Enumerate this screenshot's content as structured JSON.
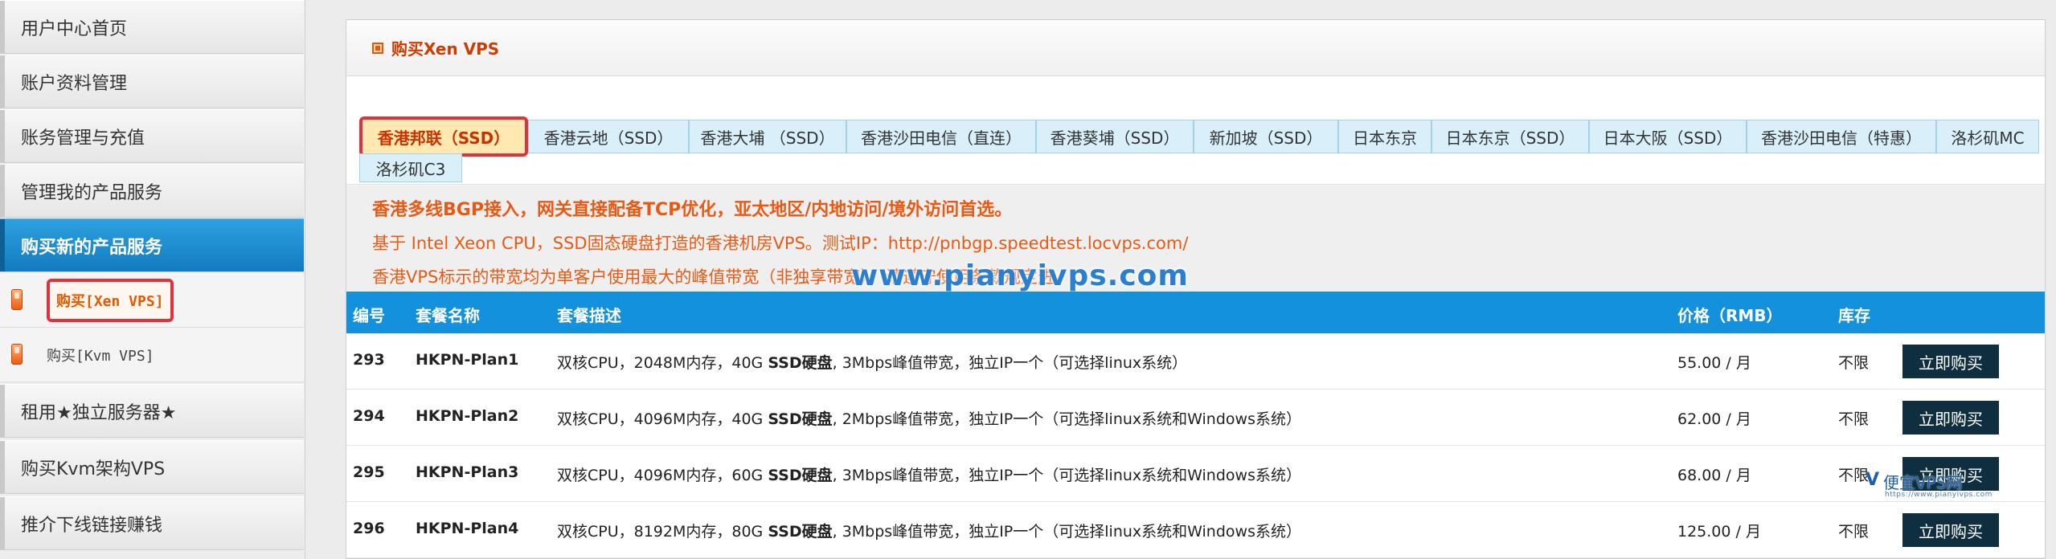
{
  "sidebar": {
    "items": [
      {
        "label": "用户中心首页"
      },
      {
        "label": "账户资料管理"
      },
      {
        "label": "账务管理与充值"
      },
      {
        "label": "管理我的产品服务"
      },
      {
        "label": "购买新的产品服务"
      },
      {
        "label": "租用★独立服务器★"
      },
      {
        "label": "购买Kvm架构VPS"
      },
      {
        "label": "推介下线链接赚钱"
      }
    ],
    "subitems": [
      {
        "label": "购买[Xen VPS]"
      },
      {
        "label": "购买[Kvm VPS]"
      }
    ]
  },
  "panel": {
    "title": "购买Xen VPS"
  },
  "tabs": [
    {
      "label": "香港邦联（SSD）"
    },
    {
      "label": "香港云地（SSD）"
    },
    {
      "label": "香港大埔 （SSD）"
    },
    {
      "label": "香港沙田电信（直连）"
    },
    {
      "label": "香港葵埔（SSD）"
    },
    {
      "label": "新加坡（SSD）"
    },
    {
      "label": "日本东京"
    },
    {
      "label": "日本东京（SSD）"
    },
    {
      "label": "日本大阪（SSD）"
    },
    {
      "label": "香港沙田电信（特惠）"
    },
    {
      "label": "洛杉矶MC"
    },
    {
      "label": "洛杉矶C3"
    }
  ],
  "intro": {
    "line1": "香港多线BGP接入，网关直接配备TCP优化，亚太地区/内地访问/境外访问首选。",
    "line2": "基于 Intel Xeon CPU，SSD固态硬盘打造的香港机房VPS。测试IP：http://pnbgp.speedtest.locvps.com/",
    "line3": "香港VPS标示的带宽均为单客户使用最大的峰值带宽（非独享带宽），请遵守使用条款规定进",
    "watermark": "www.pianyivps.com"
  },
  "table": {
    "headers": {
      "id": "编号",
      "name": "套餐名称",
      "desc": "套餐描述",
      "price": "价格（RMB）",
      "stock": "库存"
    },
    "rows": [
      {
        "id": "293",
        "name": "HKPN-Plan1",
        "desc_a": "双核CPU，2048M内存，40G ",
        "desc_b": "SSD硬盘",
        "desc_c": ", 3Mbps峰值带宽，独立IP一个（可选择linux系统）",
        "price": "55.00 / 月",
        "stock": "不限",
        "buy": "立即购买"
      },
      {
        "id": "294",
        "name": "HKPN-Plan2",
        "desc_a": "双核CPU，4096M内存，40G ",
        "desc_b": "SSD硬盘",
        "desc_c": ", 2Mbps峰值带宽，独立IP一个（可选择linux系统和Windows系统）",
        "price": "62.00 / 月",
        "stock": "不限",
        "buy": "立即购买"
      },
      {
        "id": "295",
        "name": "HKPN-Plan3",
        "desc_a": "双核CPU，4096M内存，60G ",
        "desc_b": "SSD硬盘",
        "desc_c": ", 3Mbps峰值带宽，独立IP一个（可选择linux系统和Windows系统）",
        "price": "68.00 / 月",
        "stock": "不限",
        "buy": "立即购买"
      },
      {
        "id": "296",
        "name": "HKPN-Plan4",
        "desc_a": "双核CPU，8192M内存，80G ",
        "desc_b": "SSD硬盘",
        "desc_c": ", 3Mbps峰值带宽，独立IP一个（可选择linux系统和Windows系统）",
        "price": "125.00 / 月",
        "stock": "不限",
        "buy": "立即购买"
      }
    ]
  },
  "logo_watermark": {
    "mark": "V",
    "text": "便宜VPS网",
    "sub": "https://www.pianyivps.com"
  }
}
